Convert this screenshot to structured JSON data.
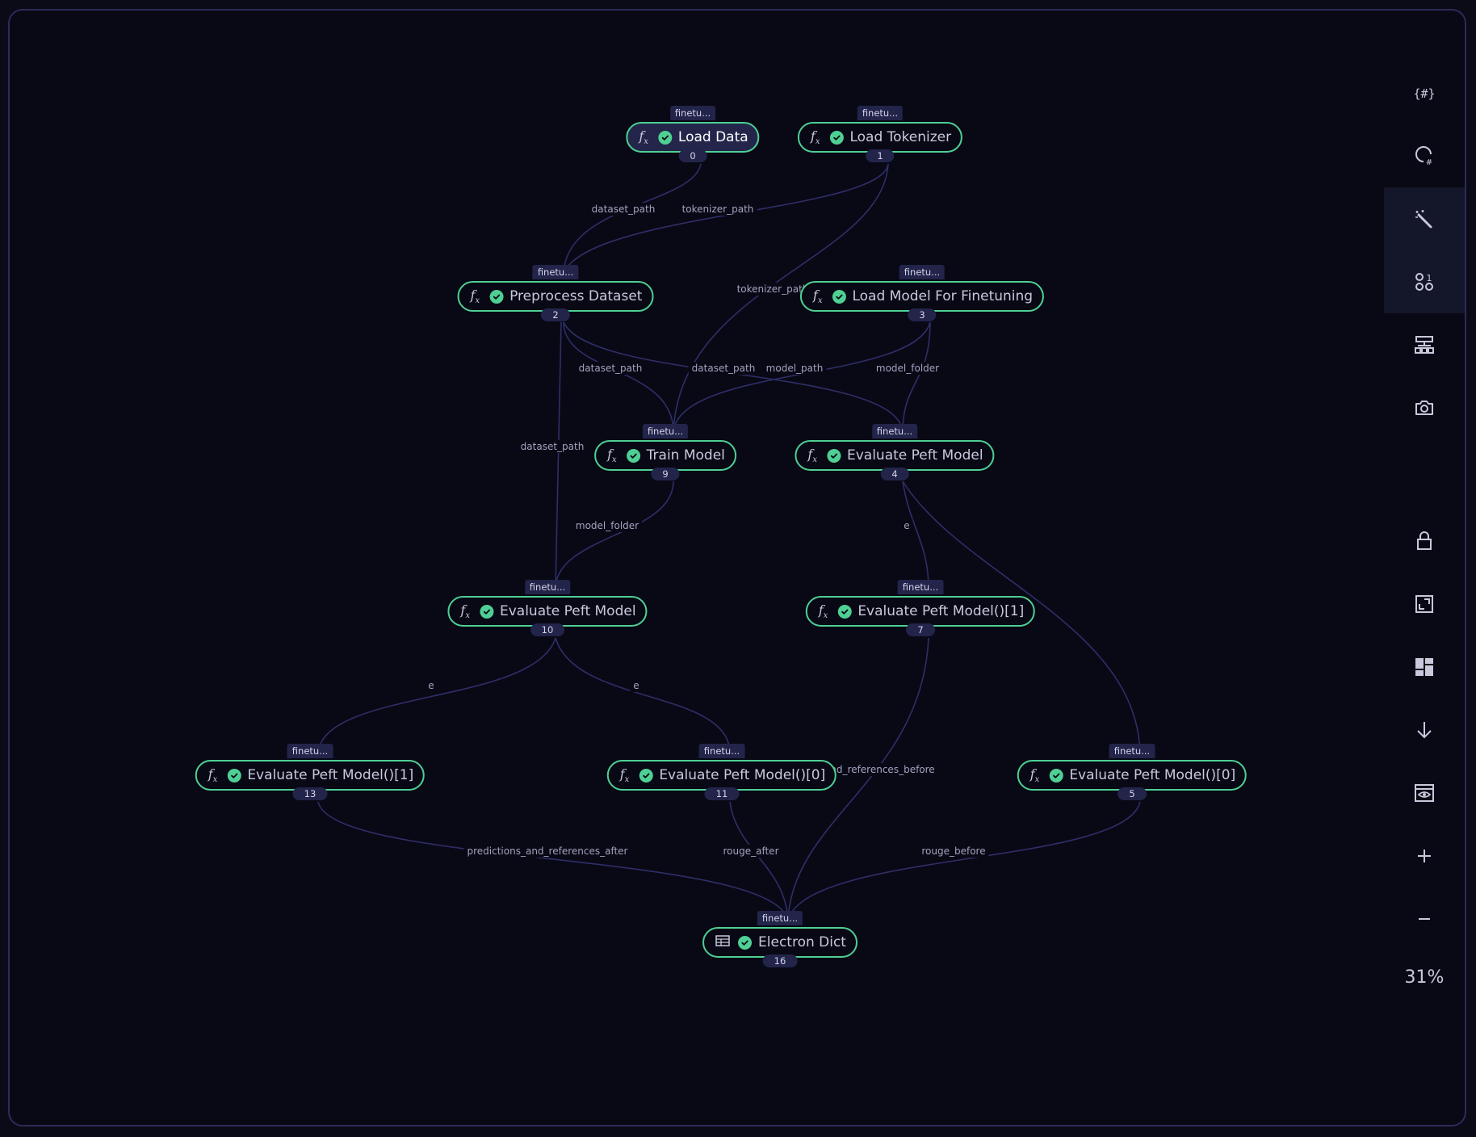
{
  "nodes": [
    {
      "label": "Load Data",
      "tag": "finetu...",
      "num": "0"
    },
    {
      "label": "Load Tokenizer",
      "tag": "finetu...",
      "num": "1"
    },
    {
      "label": "Preprocess Dataset",
      "tag": "finetu...",
      "num": "2"
    },
    {
      "label": "Load Model For Finetuning",
      "tag": "finetu...",
      "num": "3"
    },
    {
      "label": "Train Model",
      "tag": "finetu...",
      "num": "9"
    },
    {
      "label": "Evaluate Peft Model",
      "tag": "finetu...",
      "num": "4"
    },
    {
      "label": "Evaluate Peft Model",
      "tag": "finetu...",
      "num": "10"
    },
    {
      "label": "Evaluate Peft Model()[1]",
      "tag": "finetu...",
      "num": "7"
    },
    {
      "label": "Evaluate Peft Model()[1]",
      "tag": "finetu...",
      "num": "13"
    },
    {
      "label": "Evaluate Peft Model()[0]",
      "tag": "finetu...",
      "num": "11"
    },
    {
      "label": "Evaluate Peft Model()[0]",
      "tag": "finetu...",
      "num": "5"
    },
    {
      "label": "Electron Dict",
      "tag": "finetu...",
      "num": "16"
    }
  ],
  "edge_labels": [
    "dataset_path",
    "tokenizer_path",
    "tokenizer_path",
    "dataset_path",
    "dataset_path",
    "model_path",
    "model_folder",
    "dataset_path",
    "model_folder",
    "e",
    "e",
    "e",
    "nd_references_before",
    "predictions_and_references_after",
    "rouge_after",
    "rouge_before"
  ],
  "toolbar": {
    "zoom_level": "31%",
    "active_tools": [
      "magic-wand",
      "nodes"
    ]
  },
  "colors": {
    "background": "#080915",
    "frame_border": "#2c2b59",
    "edge": "#2f2e68",
    "node_border": "#4fcf94",
    "status_check": "#4fcf94",
    "tag_bg": "#22244a"
  },
  "icons": {
    "node_function": "fx-icon",
    "node_dict": "table-icon",
    "status": "check-circle-icon"
  }
}
